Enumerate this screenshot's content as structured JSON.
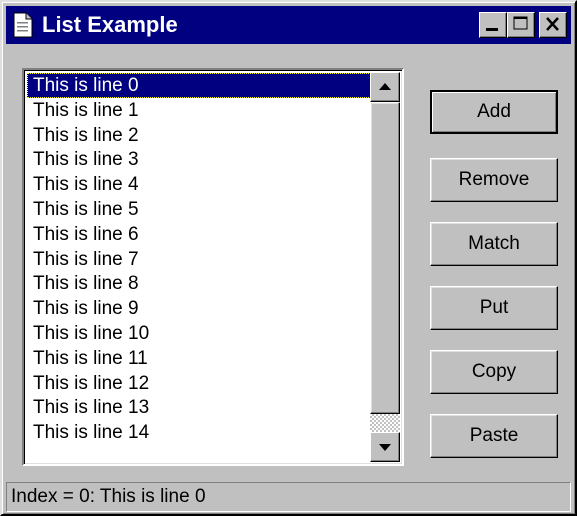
{
  "window": {
    "title": "List Example",
    "icon": "document-icon"
  },
  "titlebar_buttons": [
    "minimize-icon",
    "maximize-icon",
    "close-icon"
  ],
  "list": {
    "items": [
      "This is line 0",
      "This is line 1",
      "This is line 2",
      "This is line 3",
      "This is line 4",
      "This is line 5",
      "This is line 6",
      "This is line 7",
      "This is line 8",
      "This is line 9",
      "This is line 10",
      "This is line 11",
      "This is line 12",
      "This is line 13",
      "This is line 14"
    ],
    "selected_index": 0
  },
  "buttons": {
    "add": "Add",
    "remove": "Remove",
    "match": "Match",
    "put": "Put",
    "copy": "Copy",
    "paste": "Paste"
  },
  "status": "Index = 0: This is line 0",
  "colors": {
    "titlebar": "#000080",
    "face": "#c0c0c0",
    "selection": "#000080"
  }
}
